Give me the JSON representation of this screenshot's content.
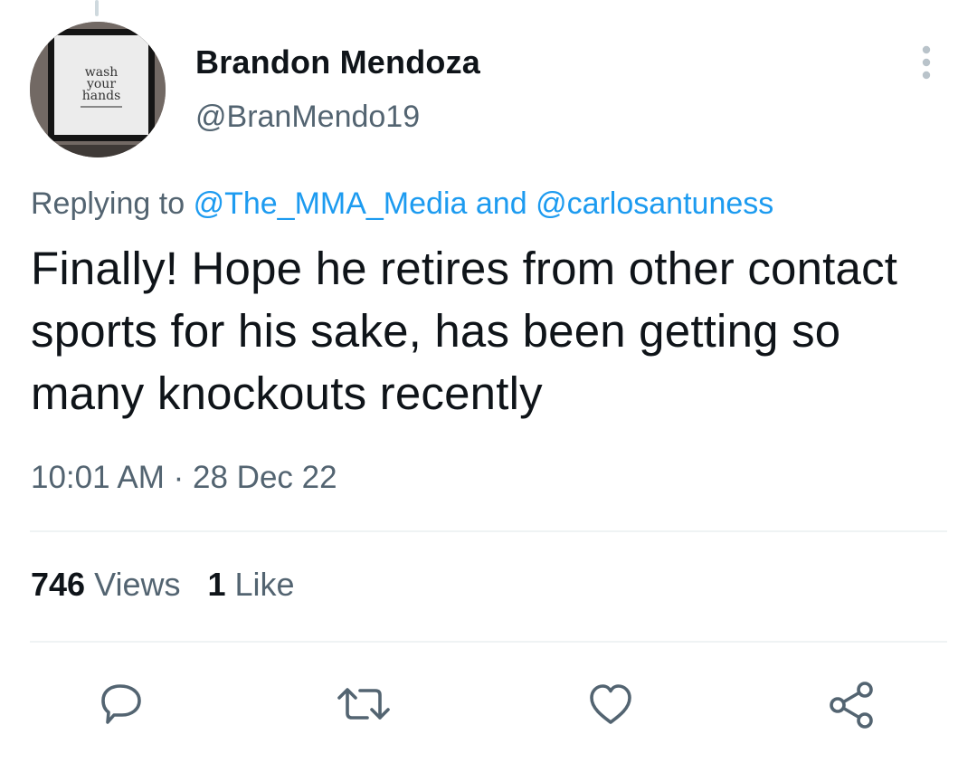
{
  "author": {
    "name": "Brandon Mendoza",
    "handle": "@BranMendo19",
    "avatar_sign": {
      "line1": "wash",
      "line2": "your",
      "line3": "hands"
    }
  },
  "reply": {
    "prefix": "Replying to",
    "mention1": "@The_MMA_Media",
    "joiner": "and",
    "mention2": "@carlosantuness"
  },
  "tweet": {
    "text": "Finally! Hope he retires from other contact sports for his sake, has been getting so many knockouts recently",
    "time": "10:01 AM",
    "separator": "·",
    "date": "28 Dec 22"
  },
  "stats": {
    "views_count": "746",
    "views_label": "Views",
    "likes_count": "1",
    "likes_label": "Like"
  },
  "actions": [
    {
      "name": "reply",
      "icon": "comment-icon"
    },
    {
      "name": "retweet",
      "icon": "retweet-icon"
    },
    {
      "name": "like",
      "icon": "heart-icon"
    },
    {
      "name": "share",
      "icon": "share-icon"
    }
  ],
  "colors": {
    "text": "#0f1419",
    "secondary": "#536471",
    "link": "#1d9bf0",
    "divider": "#eff3f4"
  }
}
